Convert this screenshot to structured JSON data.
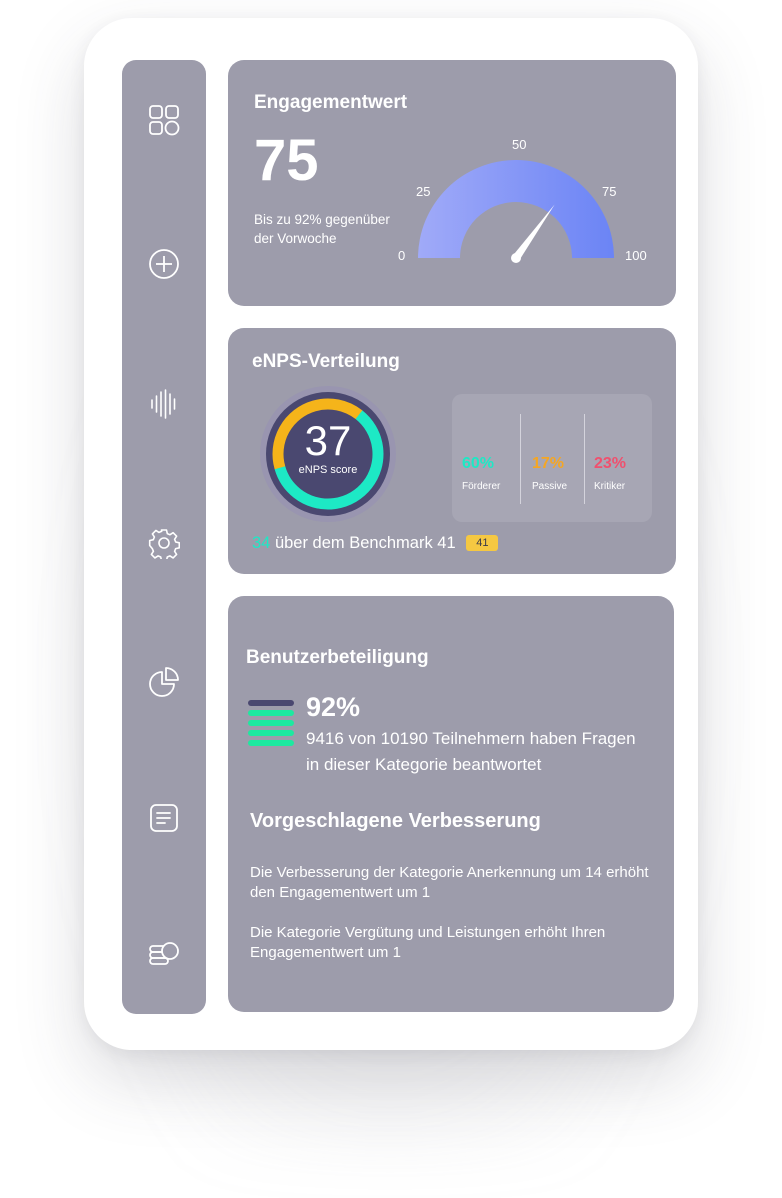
{
  "colors": {
    "card": "#9d9cab",
    "accent_teal": "#1de9c5",
    "accent_orange": "#f5a623",
    "accent_red": "#f0506e",
    "gauge_blue": "#6f86f5",
    "navy": "#4a4870",
    "badge_yellow": "#f5c842"
  },
  "sidebar": {
    "items": [
      {
        "icon": "grid-icon"
      },
      {
        "icon": "plus-circle-icon"
      },
      {
        "icon": "audio-wave-icon"
      },
      {
        "icon": "gear-icon"
      },
      {
        "icon": "pie-chart-icon"
      },
      {
        "icon": "document-icon"
      },
      {
        "icon": "coins-icon"
      }
    ]
  },
  "engagement": {
    "title": "Engagementwert",
    "value": "75",
    "subtitle": "Bis zu 92% gegenüber der Vorwoche",
    "gauge": {
      "value": 75,
      "min": 0,
      "max": 100,
      "labels": [
        "0",
        "25",
        "50",
        "75",
        "100"
      ]
    }
  },
  "enps": {
    "title": "eNPS-Verteilung",
    "score": "37",
    "score_label": "eNPS score",
    "donut": {
      "teal_fraction": 0.6,
      "orange_fraction": 0.4
    },
    "distribution": [
      {
        "pct": "60%",
        "label": "Förderer",
        "color": "#1de9c5"
      },
      {
        "pct": "17%",
        "label": "Passive",
        "color": "#f5a623"
      },
      {
        "pct": "23%",
        "label": "Kritiker",
        "color": "#f0506e"
      }
    ],
    "benchmark": {
      "delta": "34",
      "text": "über dem Benchmark 41",
      "badge": "41"
    }
  },
  "participation": {
    "title": "Benutzerbeteiligung",
    "percent": "92%",
    "text": "9416 von 10190 Teilnehmern haben Fragen in dieser Kategorie beantwortet",
    "bars": {
      "total": 5,
      "highlighted": 4
    }
  },
  "improvement": {
    "title": "Vorgeschlagene Verbesserung",
    "items": [
      "Die Verbesserung der Kategorie Anerkennung um 14 erhöht den Engagementwert um 1",
      "Die Kategorie Vergütung und Leistungen erhöht Ihren Engagementwert um 1"
    ]
  }
}
